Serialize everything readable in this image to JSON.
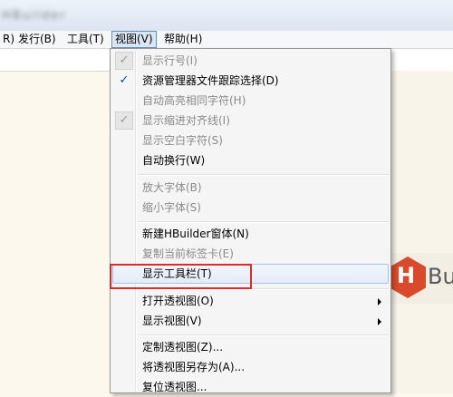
{
  "window": {
    "title": "HBuilder"
  },
  "menubar": {
    "items": [
      {
        "label": "R)"
      },
      {
        "label": "发行(B)"
      },
      {
        "label": "工具(T)"
      },
      {
        "label": "视图(V)"
      },
      {
        "label": "帮助(H)"
      }
    ]
  },
  "logo": {
    "letter": "H",
    "text": "Bui"
  },
  "view_menu": {
    "items": [
      {
        "label": "显示行号(I)"
      },
      {
        "label": "资源管理器文件跟踪选择(D)"
      },
      {
        "label": "自动高亮相同字符(H)"
      },
      {
        "label": "显示缩进对齐线(I)"
      },
      {
        "label": "显示空白字符(S)"
      },
      {
        "label": "自动换行(W)"
      },
      {
        "label": "放大字体(B)"
      },
      {
        "label": "缩小字体(S)"
      },
      {
        "label": "新建HBuilder窗体(N)"
      },
      {
        "label": "复制当前标签卡(E)"
      },
      {
        "label": "显示工具栏(T)"
      },
      {
        "label": "打开透视图(O)"
      },
      {
        "label": "显示视图(V)"
      },
      {
        "label": "定制透视图(Z)..."
      },
      {
        "label": "将透视图另存为(A)..."
      },
      {
        "label": "复位透视图..."
      }
    ]
  },
  "check_marks": {
    "on": "✓",
    "off": "✓"
  },
  "colors": {
    "highlight_box": "#e02a2a",
    "logo_accent": "#d84a2b"
  }
}
